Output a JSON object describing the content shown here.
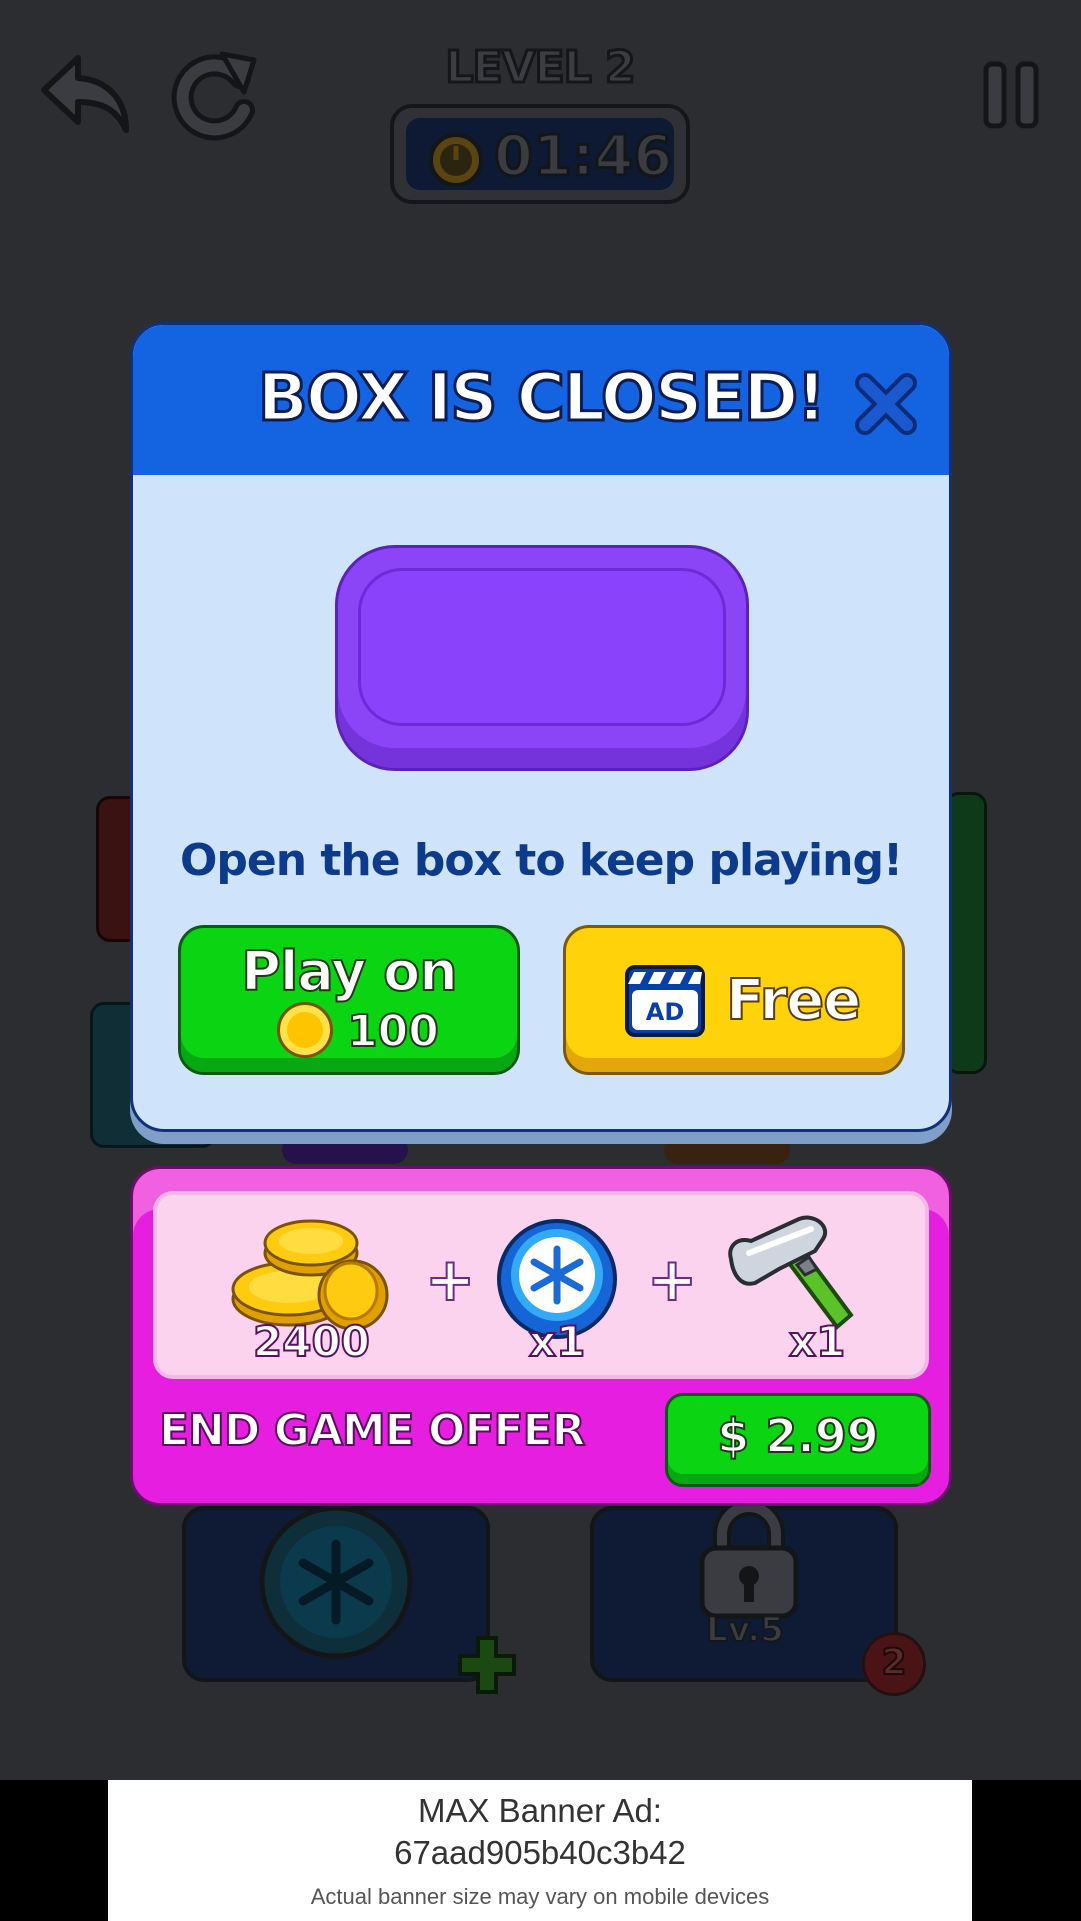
{
  "hud": {
    "level_title": "LEVEL 2",
    "timer": "01:46"
  },
  "dialog": {
    "title": "BOX IS CLOSED!",
    "message": "Open the box to keep playing!",
    "play_on_label": "Play on",
    "play_on_cost": "100",
    "free_label": "Free",
    "ad_icon_text": "AD"
  },
  "offer": {
    "items": [
      {
        "icon": "coins-stack-icon",
        "qty": "2400"
      },
      {
        "icon": "snowflake-orb-icon",
        "qty": "x1"
      },
      {
        "icon": "hammer-icon",
        "qty": "x1"
      }
    ],
    "title": "END GAME OFFER",
    "price": "$ 2.99"
  },
  "background": {
    "locked_slot_label": "Lv.5",
    "locked_slot_badge": "2"
  },
  "banner": {
    "line1": "MAX Banner Ad:",
    "line2": "67aad905b40c3b42",
    "line3": "Actual banner size may vary on mobile devices"
  },
  "colors": {
    "dialog_header": "#1463e0",
    "dialog_body": "#cfe3fb",
    "green_button": "#0bd413",
    "yellow_button": "#ffd20a",
    "offer_panel": "#e61ee0",
    "purple_box": "#8b45f7"
  }
}
